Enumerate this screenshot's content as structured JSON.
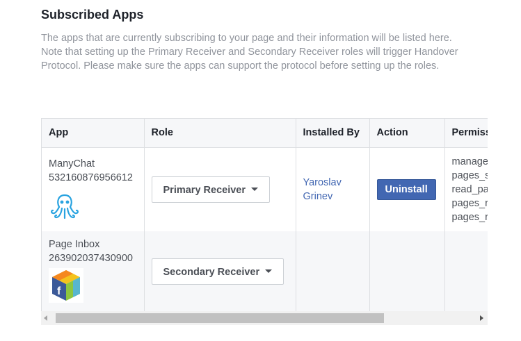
{
  "section": {
    "title": "Subscribed Apps",
    "description": "The apps that are currently subscribing to your page and their information will be listed here. Note that setting up the Primary Receiver and Secondary Receiver roles will trigger Handover Protocol. Please make sure the apps can support the protocol before setting up the roles."
  },
  "table": {
    "headers": [
      "App",
      "Role",
      "Installed By",
      "Action",
      "Permiss"
    ],
    "rows": [
      {
        "app_name": "ManyChat",
        "app_id": "532160876956612",
        "icon": "manychat-logo-icon",
        "role": "Primary Receiver",
        "installed_by_first": "Yaroslav",
        "installed_by_last": "Grinev",
        "action": "Uninstall",
        "permissions": [
          "manage",
          "pages_s",
          "read_pa",
          "pages_r",
          "pages_r"
        ]
      },
      {
        "app_name": "Page Inbox",
        "app_id": "263902037430900",
        "icon": "page-inbox-cube-icon",
        "role": "Secondary Receiver",
        "installed_by_first": "",
        "installed_by_last": "",
        "action": "",
        "permissions": []
      }
    ]
  },
  "colors": {
    "accent": "#4267b2",
    "text_muted": "#90949c",
    "header_bg": "#f6f7f9"
  }
}
